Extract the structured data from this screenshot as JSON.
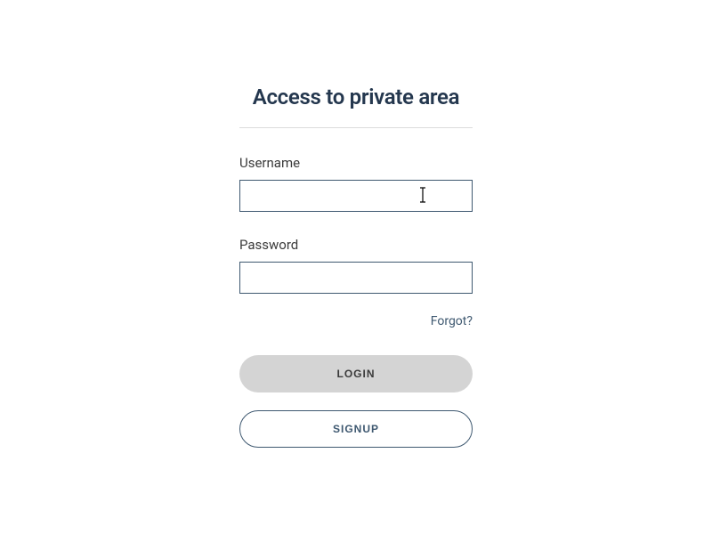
{
  "title": "Access to private area",
  "form": {
    "username_label": "Username",
    "username_value": "",
    "password_label": "Password",
    "password_value": "",
    "forgot_label": "Forgot?",
    "login_label": "LOGIN",
    "signup_label": "SIGNUP"
  }
}
